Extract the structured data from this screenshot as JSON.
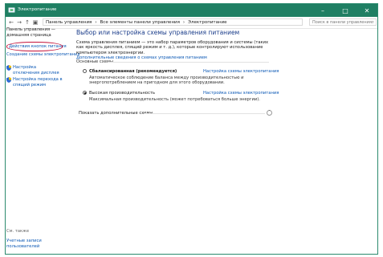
{
  "window": {
    "title": "Электропитание"
  },
  "address": {
    "crumbs": [
      "Панель управления",
      "›",
      "Все элементы панели управления",
      "›",
      "Электропитание"
    ],
    "search_placeholder": "Поиск в панели управления"
  },
  "sidebar": {
    "home": "Панель управления — домашняя страница",
    "power_buttons": "Действия кнопок питания",
    "create_plan": "Создание схемы электропитания",
    "display_off": "Настройка отключения дисплея",
    "sleep": "Настройка перехода в спящий режим",
    "see_also": "См. также",
    "accounts": "Учетные записи пользователей"
  },
  "main": {
    "heading": "Выбор или настройка схемы управления питанием",
    "description": "Схема управления питанием — это набор параметров оборудования и системы (таких как яркость дисплея, спящий режим и т. д.), которые контролируют использование компьютером электроэнергии.",
    "more_link": "Дополнительные сведения о схемах управления питанием",
    "section_title": "Основные схемы",
    "plans": [
      {
        "name": "Сбалансированная (рекомендуется)",
        "configure": "Настройка схемы электропитания",
        "desc": "Автоматическое соблюдение баланса между производительностью и энергопотреблением на пригодном для этого оборудовании.",
        "selected": false
      },
      {
        "name": "Высокая производительность",
        "configure": "Настройка схемы электропитания",
        "desc": "Максимальная производительность (может потребоваться больше энергии).",
        "selected": true
      }
    ],
    "show_more": "Показать дополнительные схемы"
  },
  "colors": {
    "titlebar": "#1f7f63",
    "link": "#0b58b5",
    "highlight": "#c4123a"
  }
}
